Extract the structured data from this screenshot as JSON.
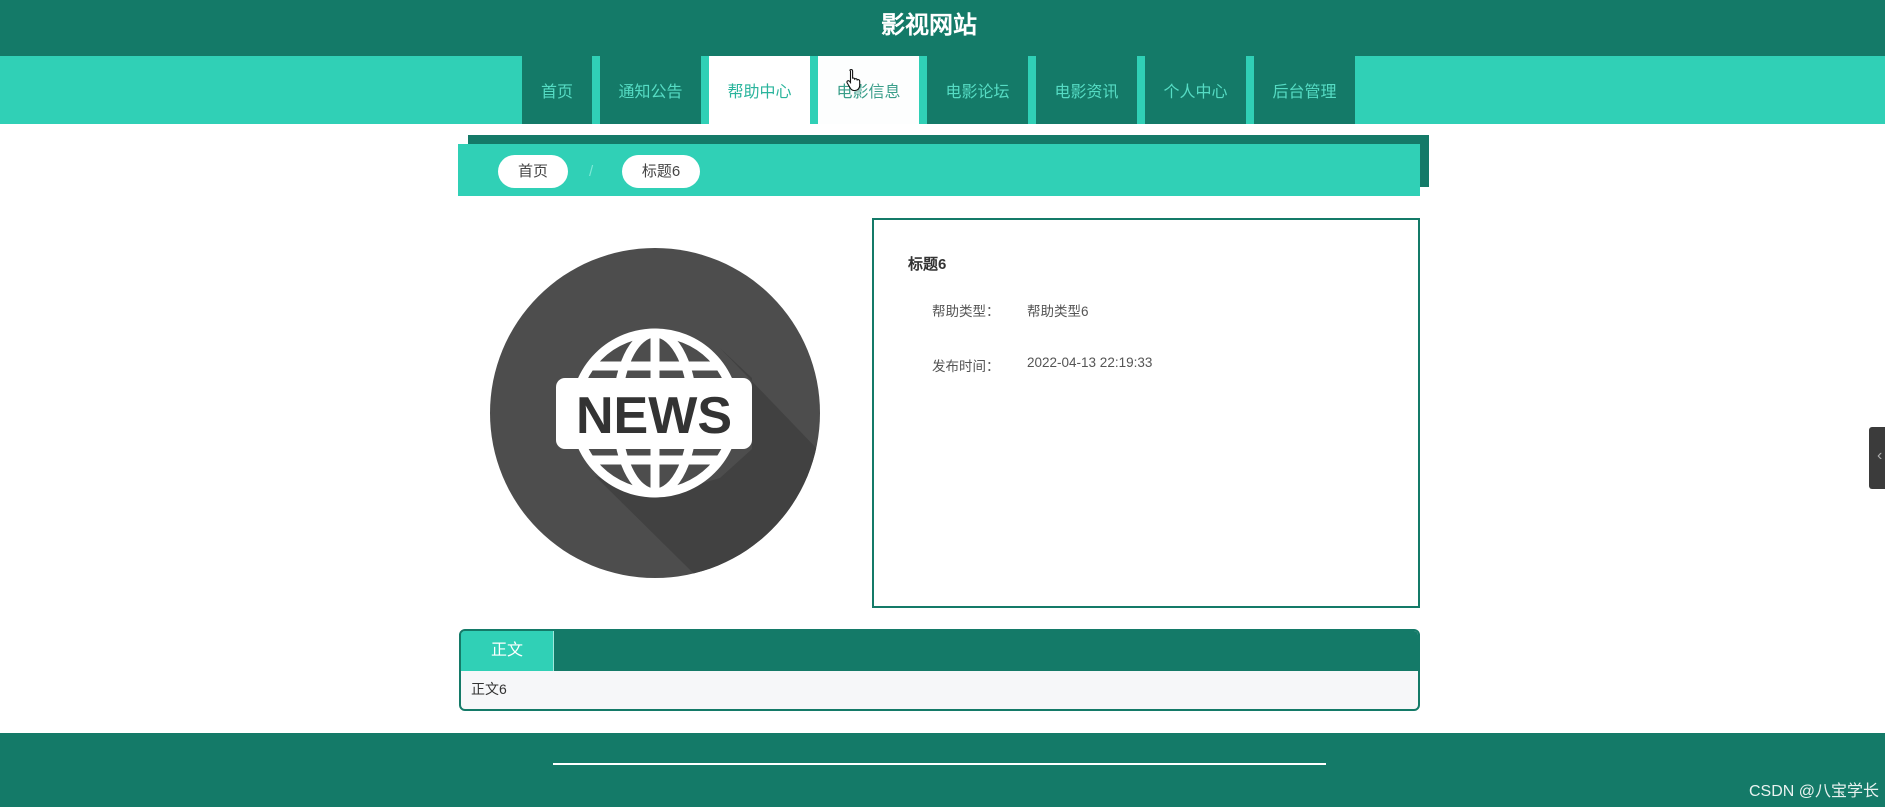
{
  "site": {
    "title": "影视网站"
  },
  "nav": {
    "items": [
      {
        "label": "首页",
        "active": false,
        "hovered": false
      },
      {
        "label": "通知公告",
        "active": false,
        "hovered": false
      },
      {
        "label": "帮助中心",
        "active": true,
        "hovered": false
      },
      {
        "label": "电影信息",
        "active": false,
        "hovered": true
      },
      {
        "label": "电影论坛",
        "active": false,
        "hovered": false
      },
      {
        "label": "电影资讯",
        "active": false,
        "hovered": false
      },
      {
        "label": "个人中心",
        "active": false,
        "hovered": false
      },
      {
        "label": "后台管理",
        "active": false,
        "hovered": false
      }
    ]
  },
  "breadcrumb": {
    "home": "首页",
    "separator": "/",
    "current": "标题6"
  },
  "hero_image": {
    "icon": "news-globe-icon",
    "badge_text": "NEWS"
  },
  "detail": {
    "title": "标题6",
    "fields": [
      {
        "label": "帮助类型：",
        "value": "帮助类型6"
      },
      {
        "label": "发布时间：",
        "value": "2022-04-13 22:19:33"
      }
    ]
  },
  "content": {
    "tab_label": "正文",
    "body": "正文6"
  },
  "watermark": "CSDN @八宝学长",
  "colors": {
    "primary_dark": "#147a68",
    "primary_light": "#30d0b6"
  }
}
